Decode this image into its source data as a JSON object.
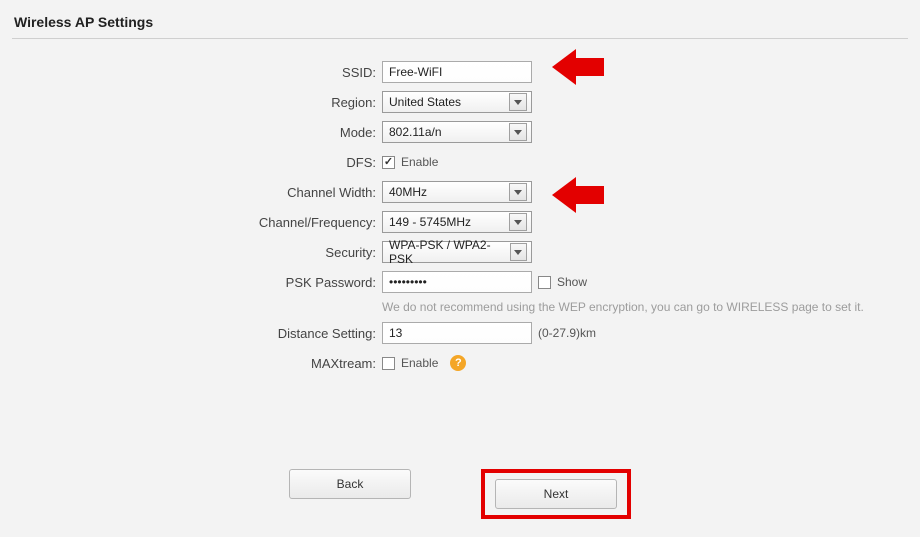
{
  "page": {
    "title": "Wireless AP Settings"
  },
  "fields": {
    "ssid_label": "SSID:",
    "ssid_value": "Free-WiFI",
    "region_label": "Region:",
    "region_value": "United States",
    "mode_label": "Mode:",
    "mode_value": "802.11a/n",
    "dfs_label": "DFS:",
    "dfs_enable_text": "Enable",
    "dfs_checked": true,
    "chwidth_label": "Channel Width:",
    "chwidth_value": "40MHz",
    "chfreq_label": "Channel/Frequency:",
    "chfreq_value": "149 - 5745MHz",
    "security_label": "Security:",
    "security_value": "WPA-PSK / WPA2-PSK",
    "psk_label": "PSK Password:",
    "psk_value": "•••••••••",
    "show_text": "Show",
    "wep_notice": "We do not recommend using the WEP encryption, you can go to WIRELESS page to set it.",
    "distance_label": "Distance Setting:",
    "distance_value": "13",
    "distance_range": "(0-27.9)km",
    "maxtream_label": "MAXtream:",
    "maxtream_enable_text": "Enable",
    "help_char": "?"
  },
  "buttons": {
    "back": "Back",
    "next": "Next"
  }
}
